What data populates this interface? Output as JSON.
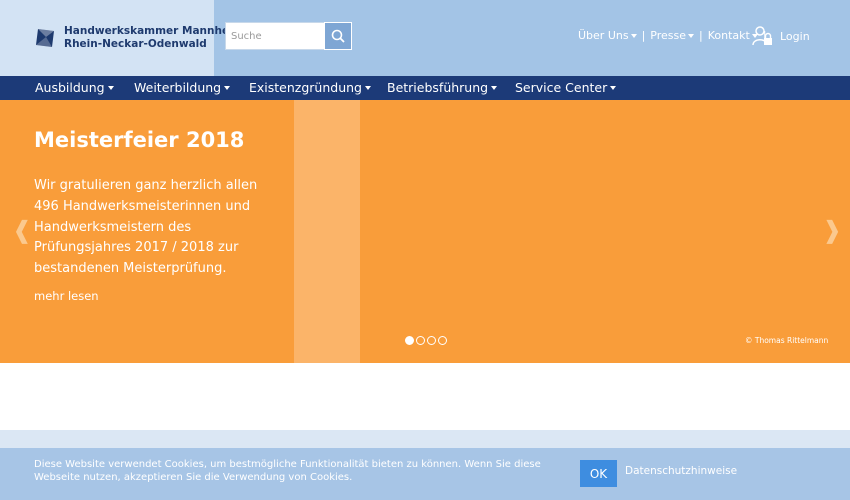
{
  "header": {
    "org_line1": "Handwerkskammer Mannheim",
    "org_line2": "Rhein-Neckar-Odenwald",
    "search_placeholder": "Suche",
    "search_icon": "search-icon",
    "top_links": [
      "Über Uns",
      "Presse",
      "Kontakt"
    ],
    "login_label": "Login",
    "login_icon": "user-lock-icon"
  },
  "mainnav": {
    "items": [
      "Ausbildung",
      "Weiterbildung",
      "Existenzgründung",
      "Betriebsführung",
      "Service Center"
    ]
  },
  "hero": {
    "title": "Meisterfeier 2018",
    "text": "Wir gratulieren ganz herzlich allen 496 Handwerksmeisterinnen und Handwerksmeistern des Prüfungsjahres 2017 / 2018 zur bestandenen Meisterprüfung.",
    "more_label": "mehr lesen",
    "credit": "© Thomas Rittelmann",
    "prev_arrow": "❰",
    "next_arrow": "❱",
    "slide_count": 4,
    "active_slide": 1
  },
  "cookie": {
    "text": "Diese Website verwendet Cookies, um bestmögliche Funktionalität bieten zu können. Wenn Sie diese Webseite nutzen, akzeptieren Sie die Verwendung von Cookies.",
    "ok_label": "OK",
    "privacy_label": "Datenschutzhinweise"
  },
  "colors": {
    "header_bg": "#a3c4e6",
    "logo_bg": "#d3e3f4",
    "nav_bg": "#1c3a78",
    "hero_bg": "#f99d3a",
    "hero_stripe": "#fbb469",
    "cookie_bg": "#a7c5e6",
    "ok_button": "#3e8de0"
  }
}
